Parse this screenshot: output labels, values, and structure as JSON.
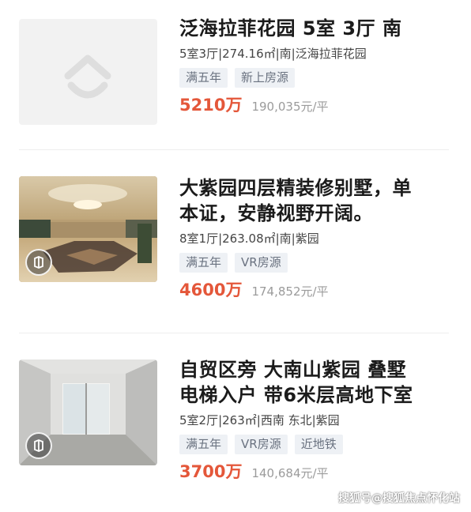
{
  "listings": [
    {
      "title": "泛海拉菲花园 5室 3厅 南",
      "meta": "5室3厅|274.16㎡|南|泛海拉菲花园",
      "tags": [
        "满五年",
        "新上房源"
      ],
      "price": "5210万",
      "unit_price": "190,035元/平",
      "has_vr": false,
      "thumb_icon": "house-placeholder-icon"
    },
    {
      "title_lines": [
        "大紫园四层精装修别墅，单",
        "本证，安静视野开阔。"
      ],
      "meta": "8室1厅|263.08㎡|南|紫园",
      "tags": [
        "满五年",
        "VR房源"
      ],
      "price": "4600万",
      "unit_price": "174,852元/平",
      "has_vr": true,
      "thumb_icon": "vr-icon"
    },
    {
      "title_lines": [
        "自贸区旁 大南山紫园 叠墅",
        "电梯入户 带6米层高地下室"
      ],
      "meta": "5室2厅|263㎡|西南 东北|紫园",
      "tags": [
        "满五年",
        "VR房源",
        "近地铁"
      ],
      "price": "3700万",
      "unit_price": "140,684元/平",
      "has_vr": true,
      "thumb_icon": "vr-icon"
    }
  ],
  "watermark": "搜狐号@搜狐焦点怀化站",
  "colors": {
    "price": "#e4573a",
    "tag_bg": "#eef1f5",
    "tag_text": "#6a7280"
  }
}
